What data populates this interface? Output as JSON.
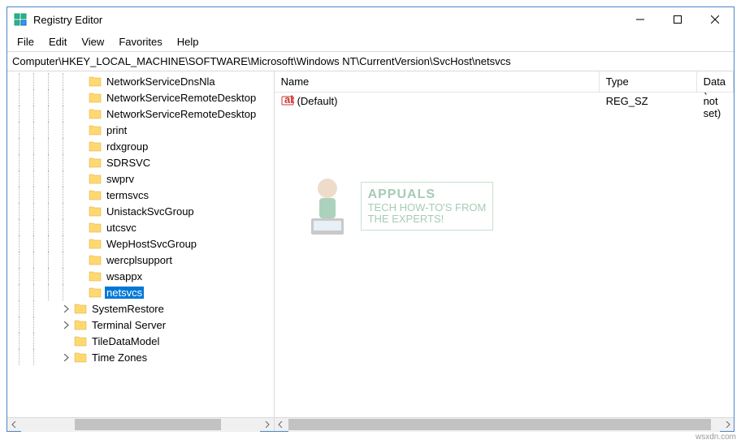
{
  "window": {
    "title": "Registry Editor"
  },
  "menu": {
    "file": "File",
    "edit": "Edit",
    "view": "View",
    "favorites": "Favorites",
    "help": "Help"
  },
  "address": "Computer\\HKEY_LOCAL_MACHINE\\SOFTWARE\\Microsoft\\Windows NT\\CurrentVersion\\SvcHost\\netsvcs",
  "tree": {
    "items": [
      {
        "indent": 4,
        "expander": "none",
        "label": "NetworkServiceDnsNla",
        "selected": false
      },
      {
        "indent": 4,
        "expander": "none",
        "label": "NetworkServiceRemoteDesktop",
        "selected": false
      },
      {
        "indent": 4,
        "expander": "none",
        "label": "NetworkServiceRemoteDesktop",
        "selected": false
      },
      {
        "indent": 4,
        "expander": "none",
        "label": "print",
        "selected": false
      },
      {
        "indent": 4,
        "expander": "none",
        "label": "rdxgroup",
        "selected": false
      },
      {
        "indent": 4,
        "expander": "none",
        "label": "SDRSVC",
        "selected": false
      },
      {
        "indent": 4,
        "expander": "none",
        "label": "swprv",
        "selected": false
      },
      {
        "indent": 4,
        "expander": "none",
        "label": "termsvcs",
        "selected": false
      },
      {
        "indent": 4,
        "expander": "none",
        "label": "UnistackSvcGroup",
        "selected": false
      },
      {
        "indent": 4,
        "expander": "none",
        "label": "utcsvc",
        "selected": false
      },
      {
        "indent": 4,
        "expander": "none",
        "label": "WepHostSvcGroup",
        "selected": false
      },
      {
        "indent": 4,
        "expander": "none",
        "label": "wercplsupport",
        "selected": false
      },
      {
        "indent": 4,
        "expander": "none",
        "label": "wsappx",
        "selected": false
      },
      {
        "indent": 4,
        "expander": "none",
        "label": "netsvcs",
        "selected": true
      },
      {
        "indent": 3,
        "expander": "closed",
        "label": "SystemRestore",
        "selected": false
      },
      {
        "indent": 3,
        "expander": "closed",
        "label": "Terminal Server",
        "selected": false
      },
      {
        "indent": 3,
        "expander": "none",
        "label": "TileDataModel",
        "selected": false
      },
      {
        "indent": 3,
        "expander": "closed",
        "label": "Time Zones",
        "selected": false
      }
    ]
  },
  "list": {
    "columns": {
      "name": "Name",
      "type": "Type",
      "data": "Data"
    },
    "rows": [
      {
        "name": "(Default)",
        "type": "REG_SZ",
        "data": "(value not set)"
      }
    ]
  },
  "watermark": {
    "title": "APPUALS",
    "sub1": "TECH HOW-TO'S FROM",
    "sub2": "THE EXPERTS!"
  },
  "footer": "wsxdn.com"
}
